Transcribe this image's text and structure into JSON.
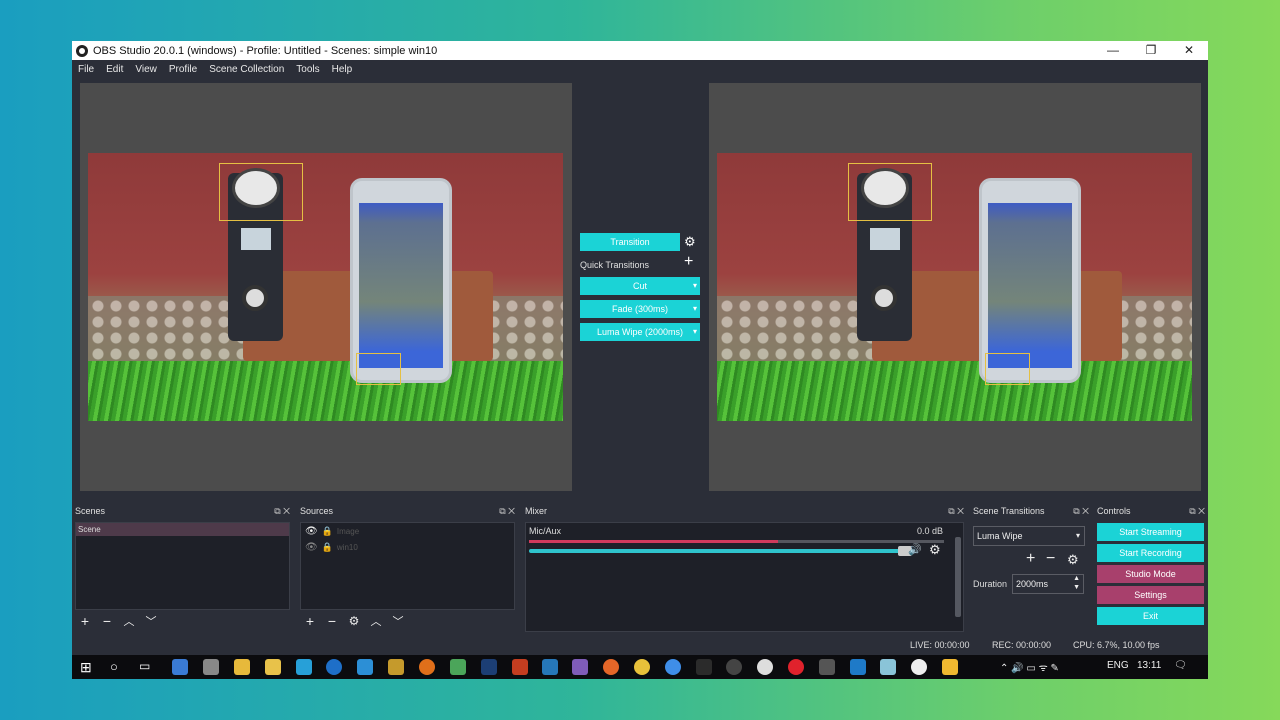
{
  "window": {
    "title": "OBS Studio 20.0.1 (windows) - Profile: Untitled - Scenes: simple win10",
    "minimize": "—",
    "maximize": "❐",
    "close": "✕"
  },
  "menu": [
    "File",
    "Edit",
    "View",
    "Profile",
    "Scene Collection",
    "Tools",
    "Help"
  ],
  "transition_panel": {
    "transition_label": "Transition",
    "quick_transitions_label": "Quick Transitions",
    "items": [
      "Cut",
      "Fade (300ms)",
      "Luma Wipe (2000ms)"
    ]
  },
  "docks": {
    "scenes": {
      "title": "Scenes",
      "items": [
        "Scene"
      ]
    },
    "sources": {
      "title": "Sources",
      "items": [
        "Image",
        "win10"
      ]
    },
    "mixer": {
      "title": "Mixer",
      "channel": "Mic/Aux",
      "level": "0.0 dB"
    },
    "scene_transitions": {
      "title": "Scene Transitions",
      "selected": "Luma Wipe",
      "duration_label": "Duration",
      "duration_value": "2000ms"
    },
    "controls": {
      "title": "Controls",
      "start_streaming": "Start Streaming",
      "start_recording": "Start Recording",
      "studio_mode": "Studio Mode",
      "settings": "Settings",
      "exit": "Exit"
    }
  },
  "status": {
    "live": "LIVE: 00:00:00",
    "rec": "REC: 00:00:00",
    "cpu": "CPU: 6.7%, 10.00 fps"
  },
  "taskbar": {
    "language": "ENG",
    "time": "13:11"
  },
  "colors": {
    "accent": "#1bd3d6",
    "studio_button": "#a8406c",
    "window_bg": "#2b2e38",
    "preview_bg": "#4c4c4c"
  }
}
